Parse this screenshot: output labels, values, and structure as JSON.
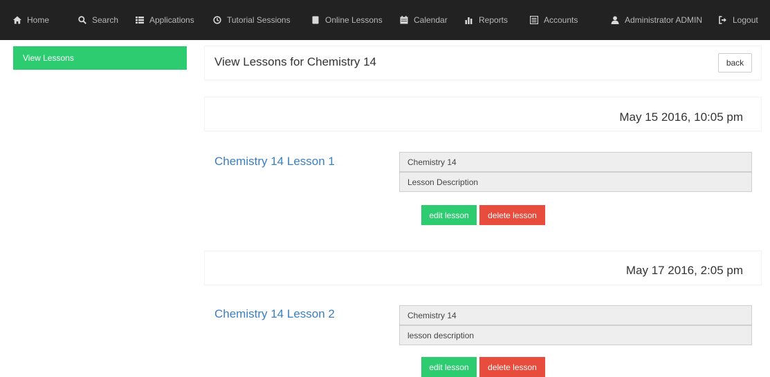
{
  "navbar": {
    "items": [
      {
        "label": "Home",
        "icon": "home-icon"
      },
      {
        "label": "Search",
        "icon": "search-icon"
      },
      {
        "label": "Applications",
        "icon": "list-icon"
      },
      {
        "label": "Tutorial Sessions",
        "icon": "clock-icon"
      },
      {
        "label": "Online Lessons",
        "icon": "book-icon"
      },
      {
        "label": "Calendar",
        "icon": "calendar-icon"
      },
      {
        "label": "Reports",
        "icon": "bar-chart-icon"
      },
      {
        "label": "Accounts",
        "icon": "list-alt-icon"
      },
      {
        "label": "Administrator ADMIN",
        "icon": "user-icon"
      },
      {
        "label": "Logout",
        "icon": "logout-icon"
      }
    ]
  },
  "sidebar": {
    "active_item": "View Lessons"
  },
  "header": {
    "title": "View Lessons for Chemistry 14",
    "back_label": "back"
  },
  "lessons": [
    {
      "date": "May 15 2016, 10:05 pm",
      "title": "Chemistry 14 Lesson 1",
      "course": "Chemistry 14",
      "description": "Lesson Description",
      "edit_label": "edit lesson",
      "delete_label": "delete lesson"
    },
    {
      "date": "May 17 2016, 2:05 pm",
      "title": "Chemistry 14 Lesson 2",
      "course": "Chemistry 14",
      "description": "lesson description",
      "edit_label": "edit lesson",
      "delete_label": "delete lesson"
    }
  ],
  "colors": {
    "navbar_bg": "#222222",
    "accent_green": "#2ecc71",
    "danger_red": "#e74c3c",
    "link_blue": "#3a7fc1"
  }
}
